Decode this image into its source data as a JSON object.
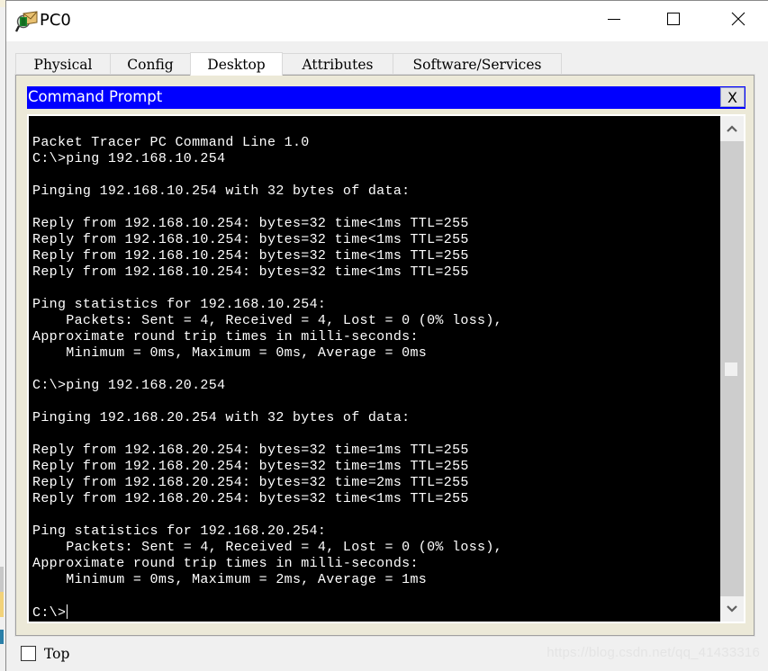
{
  "window": {
    "title": "PC0",
    "icon": "packet-tracer-pc-icon",
    "controls": {
      "minimize_icon": "minimize-icon",
      "maximize_icon": "maximize-icon",
      "close_icon": "close-icon"
    }
  },
  "tabs": [
    {
      "label": "Physical",
      "active": false
    },
    {
      "label": "Config",
      "active": false
    },
    {
      "label": "Desktop",
      "active": true
    },
    {
      "label": "Attributes",
      "active": false
    },
    {
      "label": "Software/Services",
      "active": false
    }
  ],
  "command_prompt": {
    "title": "Command Prompt",
    "close_label": "X",
    "lines": [
      "Packet Tracer PC Command Line 1.0",
      "C:\\>ping 192.168.10.254",
      "",
      "Pinging 192.168.10.254 with 32 bytes of data:",
      "",
      "Reply from 192.168.10.254: bytes=32 time<1ms TTL=255",
      "Reply from 192.168.10.254: bytes=32 time<1ms TTL=255",
      "Reply from 192.168.10.254: bytes=32 time<1ms TTL=255",
      "Reply from 192.168.10.254: bytes=32 time<1ms TTL=255",
      "",
      "Ping statistics for 192.168.10.254:",
      "    Packets: Sent = 4, Received = 4, Lost = 0 (0% loss),",
      "Approximate round trip times in milli-seconds:",
      "    Minimum = 0ms, Maximum = 0ms, Average = 0ms",
      "",
      "C:\\>ping 192.168.20.254",
      "",
      "Pinging 192.168.20.254 with 32 bytes of data:",
      "",
      "Reply from 192.168.20.254: bytes=32 time=1ms TTL=255",
      "Reply from 192.168.20.254: bytes=32 time=1ms TTL=255",
      "Reply from 192.168.20.254: bytes=32 time=2ms TTL=255",
      "Reply from 192.168.20.254: bytes=32 time<1ms TTL=255",
      "",
      "Ping statistics for 192.168.20.254:",
      "    Packets: Sent = 4, Received = 4, Lost = 0 (0% loss),",
      "Approximate round trip times in milli-seconds:",
      "    Minimum = 0ms, Maximum = 2ms, Average = 1ms",
      ""
    ],
    "prompt": "C:\\>",
    "scroll_position": 0.5
  },
  "footer": {
    "top_checkbox_label": "Top",
    "top_checked": false,
    "watermark": "https://blog.csdn.net/qq_41433316"
  },
  "colors": {
    "header_blue": "#0000ff",
    "terminal_bg": "#000000",
    "terminal_fg": "#ffffff",
    "panel_beige": "#ece9d8"
  }
}
